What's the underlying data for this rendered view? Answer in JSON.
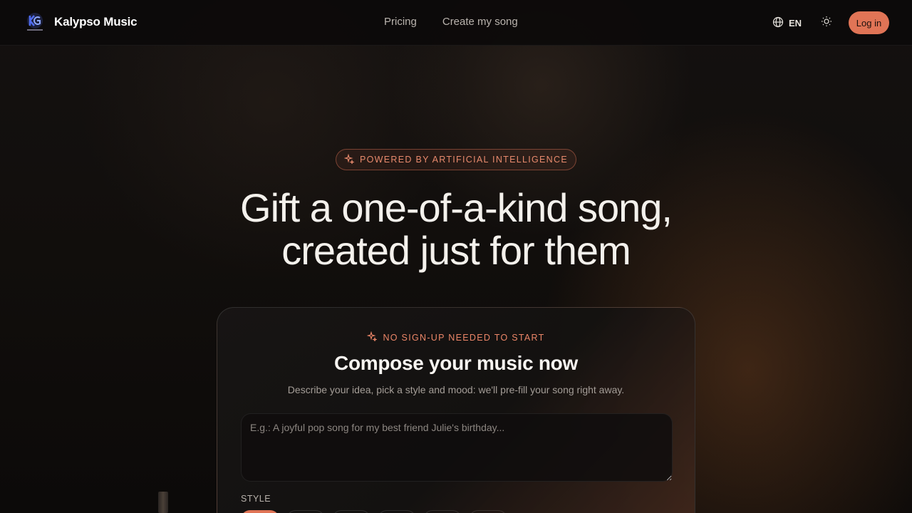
{
  "brand": {
    "name": "Kalypso Music",
    "logo_icon": "kalypso-logo"
  },
  "nav": {
    "items": [
      {
        "label": "Pricing"
      },
      {
        "label": "Create my song"
      }
    ]
  },
  "header": {
    "lang_label": "EN",
    "login_label": "Log in"
  },
  "hero": {
    "badge": "POWERED BY ARTIFICIAL INTELLIGENCE",
    "title_line1": "Gift a one-of-a-kind song,",
    "title_line2": "created just for them"
  },
  "composer": {
    "hint": "NO SIGN-UP NEEDED TO START",
    "title": "Compose your music now",
    "subtitle": "Describe your idea, pick a style and mood: we'll pre-fill your song right away.",
    "placeholder": "E.g.: A joyful pop song for my best friend Julie's birthday...",
    "value": "",
    "style_label": "STYLE"
  },
  "colors": {
    "accent": "#e07456",
    "accent_text": "#e88a6d",
    "background": "#0d0b0a"
  }
}
